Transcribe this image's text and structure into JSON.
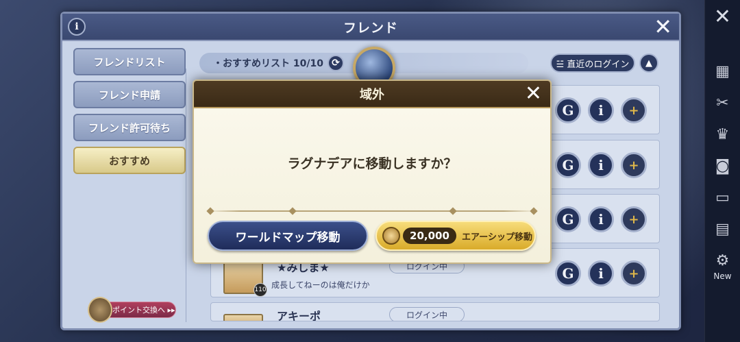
{
  "window": {
    "title": "フレンド",
    "info_icon": "info-icon",
    "close_icon": "close-icon"
  },
  "tabs": [
    {
      "label": "フレンドリスト",
      "active": false
    },
    {
      "label": "フレンド申請",
      "active": false
    },
    {
      "label": "フレンド許可待ち",
      "active": false
    },
    {
      "label": "おすすめ",
      "active": true
    }
  ],
  "point_exchange": {
    "label": "ポイント交換へ ▸▸"
  },
  "list_header": {
    "label": "・おすすめリスト 10/10"
  },
  "sort": {
    "label": "☱ 直近のログイン",
    "arrow": "▲"
  },
  "rows": [
    {
      "name": "",
      "comment": "",
      "status": ""
    },
    {
      "name": "",
      "comment": "",
      "status": ""
    },
    {
      "name": "",
      "comment": "",
      "status": ""
    },
    {
      "name": "★みしま★",
      "comment": "成長してねーのは俺だけか",
      "status": "ログイン中",
      "level": "110"
    },
    {
      "name": "アキーポ",
      "comment": "",
      "status": "ログイン中"
    }
  ],
  "row_buttons": {
    "guild": "G",
    "info": "i",
    "add": "+"
  },
  "modal": {
    "title": "域外",
    "close": "✕",
    "message": "ラグナデアに移動しますか？",
    "worldmap_button": "ワールドマップ移動",
    "airship_cost": "20,000",
    "airship_button": "エアーシップ移動"
  },
  "side_menu": {
    "close": "✕",
    "new_label": "New"
  },
  "colors": {
    "accent": "#2c3a60",
    "gold": "#d9ab2a",
    "modal_header": "#3a2a16"
  }
}
